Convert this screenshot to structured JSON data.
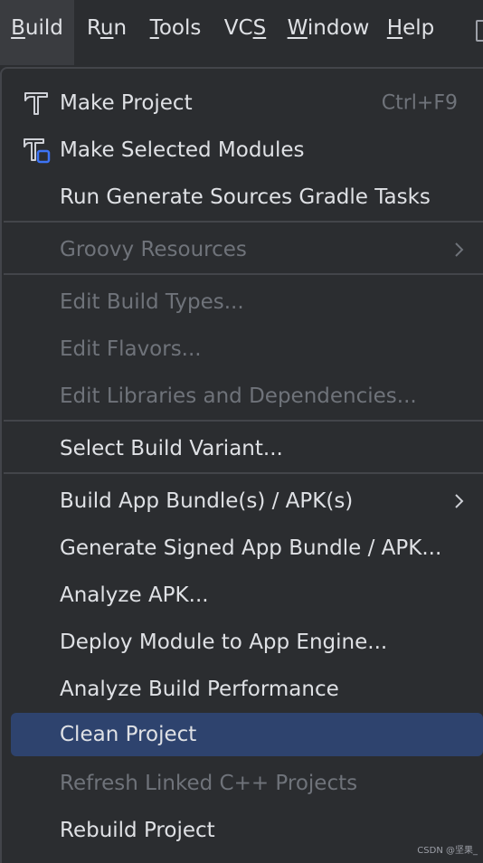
{
  "menubar": {
    "items": [
      {
        "label": "Build",
        "mnemonic": "B",
        "rest": "uild",
        "active": true
      },
      {
        "label": "Run",
        "pre": "R",
        "mnemonic": "u",
        "rest": "n"
      },
      {
        "label": "Tools",
        "mnemonic": "T",
        "rest": "ools"
      },
      {
        "label": "VCS",
        "pre": "VC",
        "mnemonic": "S",
        "rest": ""
      },
      {
        "label": "Window",
        "mnemonic": "W",
        "rest": "indow"
      },
      {
        "label": "Help",
        "mnemonic": "H",
        "rest": "elp"
      }
    ]
  },
  "build_menu": {
    "groups": [
      {
        "items": [
          {
            "label": "Make Project",
            "shortcut": "Ctrl+F9",
            "icon": "hammer-icon",
            "enabled": true
          },
          {
            "label": "Make Selected Modules",
            "icon": "hammer-module-icon",
            "enabled": true
          },
          {
            "label": "Run Generate Sources Gradle Tasks",
            "enabled": true
          }
        ]
      },
      {
        "items": [
          {
            "label": "Groovy Resources",
            "submenu": true,
            "enabled": false
          }
        ]
      },
      {
        "items": [
          {
            "label": "Edit Build Types...",
            "enabled": false
          },
          {
            "label": "Edit Flavors...",
            "enabled": false
          },
          {
            "label": "Edit Libraries and Dependencies...",
            "enabled": false
          }
        ]
      },
      {
        "items": [
          {
            "label": "Select Build Variant...",
            "enabled": true
          }
        ]
      },
      {
        "items": [
          {
            "label": "Build App Bundle(s) / APK(s)",
            "submenu": true,
            "enabled": true
          },
          {
            "label": "Generate Signed App Bundle / APK...",
            "enabled": true
          },
          {
            "label": "Analyze APK...",
            "enabled": true
          },
          {
            "label": "Deploy Module to App Engine...",
            "enabled": true
          },
          {
            "label": "Analyze Build Performance",
            "enabled": true
          },
          {
            "label": "Clean Project",
            "enabled": true,
            "selected": true
          },
          {
            "label": "Refresh Linked C++ Projects",
            "enabled": false
          },
          {
            "label": "Rebuild Project",
            "enabled": true
          }
        ]
      }
    ]
  },
  "watermark": "CSDN @坚果_",
  "colors": {
    "background": "#2b2d30",
    "text": "#dfe1e5",
    "disabled_text": "#6f737a",
    "selection": "#2e436e",
    "separator": "#43454a",
    "icon_accent": "#3d74f5"
  }
}
